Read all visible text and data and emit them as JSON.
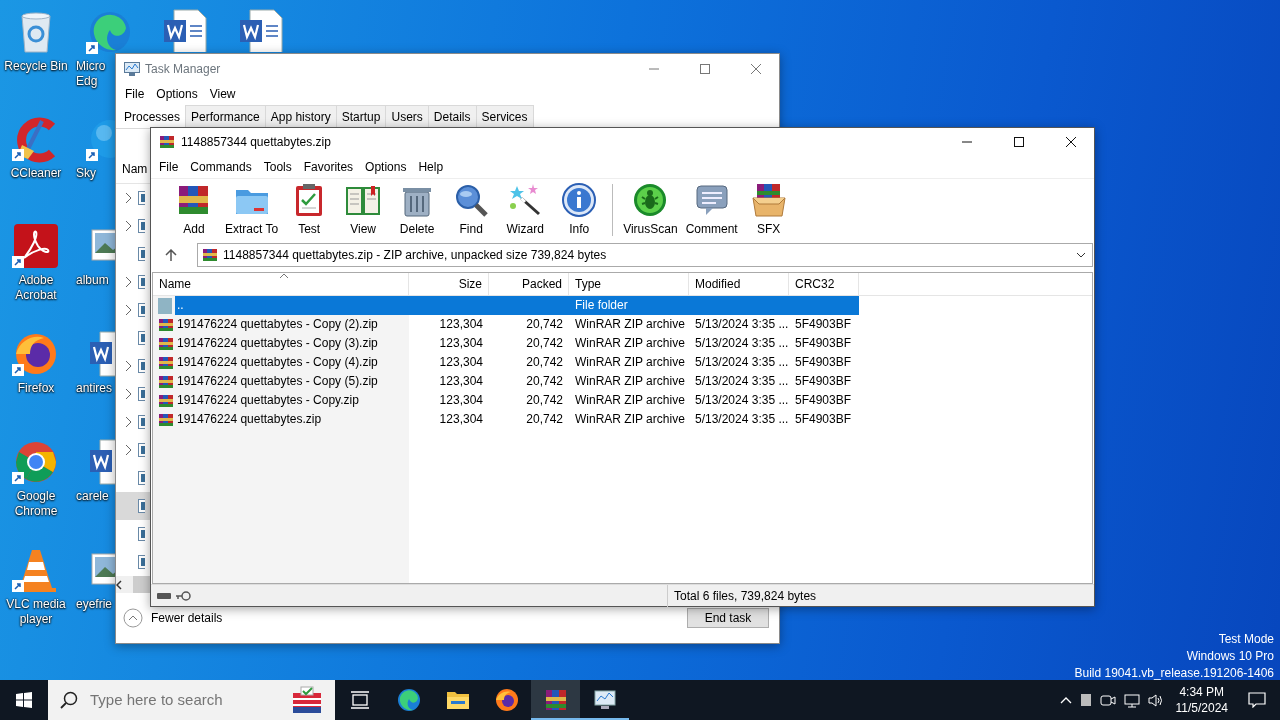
{
  "desktop": {
    "icons": [
      {
        "label": "Recycle Bin"
      },
      {
        "label": "Micro Edg"
      },
      {
        "label": "CCleaner"
      },
      {
        "label": "Sky"
      },
      {
        "label": "Adobe Acrobat"
      },
      {
        "label": "album"
      },
      {
        "label": "Firefox"
      },
      {
        "label": "antires"
      },
      {
        "label": "Google Chrome"
      },
      {
        "label": "carele"
      },
      {
        "label": "VLC media player"
      },
      {
        "label": "eyefrie"
      }
    ],
    "system_text": [
      "Test Mode",
      "Windows 10 Pro",
      "Build 19041.vb_release.191206-1406"
    ]
  },
  "task_manager": {
    "title": "Task Manager",
    "menu": [
      "File",
      "Options",
      "View"
    ],
    "tabs": [
      {
        "label": "Processes",
        "selected": true
      },
      {
        "label": "Performance",
        "selected": false
      },
      {
        "label": "App history",
        "selected": false
      },
      {
        "label": "Startup",
        "selected": false
      },
      {
        "label": "Users",
        "selected": false
      },
      {
        "label": "Details",
        "selected": false
      },
      {
        "label": "Services",
        "selected": false
      }
    ],
    "column_header": "Nam",
    "rows": [
      {
        "expandable": true,
        "selected": false
      },
      {
        "expandable": true,
        "selected": false
      },
      {
        "expandable": false,
        "selected": false
      },
      {
        "expandable": true,
        "selected": false
      },
      {
        "expandable": true,
        "selected": false
      },
      {
        "expandable": false,
        "selected": false
      },
      {
        "expandable": true,
        "selected": false
      },
      {
        "expandable": true,
        "selected": false
      },
      {
        "expandable": true,
        "selected": false
      },
      {
        "expandable": true,
        "selected": false
      },
      {
        "expandable": false,
        "selected": false
      },
      {
        "expandable": false,
        "selected": true
      },
      {
        "expandable": false,
        "selected": false
      },
      {
        "expandable": false,
        "selected": false
      }
    ],
    "fewer_details": "Fewer details",
    "end_task": "End task"
  },
  "winrar": {
    "title": "1148857344 quettabytes.zip",
    "menu": [
      "File",
      "Commands",
      "Tools",
      "Favorites",
      "Options",
      "Help"
    ],
    "toolbar": [
      "Add",
      "Extract To",
      "Test",
      "View",
      "Delete",
      "Find",
      "Wizard",
      "Info",
      "VirusScan",
      "Comment",
      "SFX"
    ],
    "address": "1148857344 quettabytes.zip - ZIP archive, unpacked size 739,824 bytes",
    "columns": [
      "Name",
      "Size",
      "Packed",
      "Type",
      "Modified",
      "CRC32"
    ],
    "rows": [
      {
        "kind": "parent",
        "name": "..",
        "size": "",
        "packed": "",
        "type": "File folder",
        "modified": "",
        "crc": "",
        "selected": true
      },
      {
        "kind": "archive",
        "name": "191476224 quettabytes - Copy (2).zip",
        "size": "123,304",
        "packed": "20,742",
        "type": "WinRAR ZIP archive",
        "modified": "5/13/2024 3:35 ...",
        "crc": "5F4903BF",
        "selected": false
      },
      {
        "kind": "archive",
        "name": "191476224 quettabytes - Copy (3).zip",
        "size": "123,304",
        "packed": "20,742",
        "type": "WinRAR ZIP archive",
        "modified": "5/13/2024 3:35 ...",
        "crc": "5F4903BF",
        "selected": false
      },
      {
        "kind": "archive",
        "name": "191476224 quettabytes - Copy (4).zip",
        "size": "123,304",
        "packed": "20,742",
        "type": "WinRAR ZIP archive",
        "modified": "5/13/2024 3:35 ...",
        "crc": "5F4903BF",
        "selected": false
      },
      {
        "kind": "archive",
        "name": "191476224 quettabytes - Copy (5).zip",
        "size": "123,304",
        "packed": "20,742",
        "type": "WinRAR ZIP archive",
        "modified": "5/13/2024 3:35 ...",
        "crc": "5F4903BF",
        "selected": false
      },
      {
        "kind": "archive",
        "name": "191476224 quettabytes - Copy.zip",
        "size": "123,304",
        "packed": "20,742",
        "type": "WinRAR ZIP archive",
        "modified": "5/13/2024 3:35 ...",
        "crc": "5F4903BF",
        "selected": false
      },
      {
        "kind": "archive",
        "name": "191476224 quettabytes.zip",
        "size": "123,304",
        "packed": "20,742",
        "type": "WinRAR ZIP archive",
        "modified": "5/13/2024 3:35 ...",
        "crc": "5F4903BF",
        "selected": false
      }
    ],
    "status": "Total 6 files, 739,824 bytes"
  },
  "taskbar": {
    "search_placeholder": "Type here to search",
    "apps": [
      {
        "running": false,
        "active": false
      },
      {
        "running": false,
        "active": false
      },
      {
        "running": false,
        "active": false
      },
      {
        "running": false,
        "active": false
      },
      {
        "running": true,
        "active": true
      },
      {
        "running": true,
        "active": false
      }
    ],
    "time": "4:34 PM",
    "date": "11/5/2024"
  }
}
